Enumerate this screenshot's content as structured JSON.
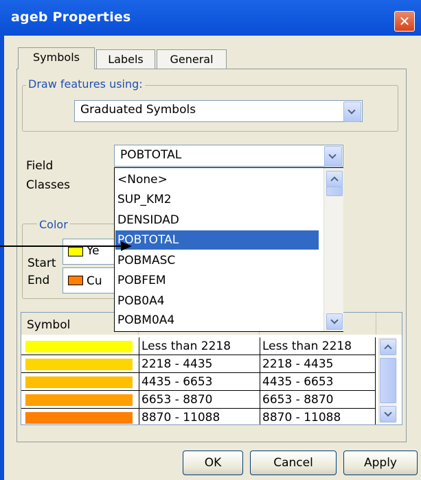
{
  "window": {
    "title": "ageb Properties",
    "close_glyph": "✕"
  },
  "tabs": [
    {
      "label": "Symbols",
      "active": true
    },
    {
      "label": "Labels",
      "active": false
    },
    {
      "label": "General",
      "active": false
    }
  ],
  "draw_group": {
    "legend": "Draw features using:",
    "selected": "Graduated Symbols"
  },
  "field": {
    "label": "Field",
    "selected": "POBTOTAL",
    "options": [
      "<None>",
      "SUP_KM2",
      "DENSIDAD",
      "POBTOTAL",
      "POBMASC",
      "POBFEM",
      "POB0A4",
      "POBM0A4"
    ],
    "highlighted_index": 3
  },
  "classes": {
    "label": "Classes"
  },
  "color_group": {
    "legend": "Color",
    "start_label": "Start",
    "start_value": "Ye",
    "start_color": "#ffff00",
    "end_label": "End",
    "end_value": "Cu",
    "end_color": "#ff7f00"
  },
  "symbol_table": {
    "header_symbol": "Symbol",
    "rows": [
      {
        "color": "#ffff00",
        "range": "Less than 2218",
        "label": "Less than 2218"
      },
      {
        "color": "#ffd500",
        "range": "2218 - 4435",
        "label": "2218 - 4435"
      },
      {
        "color": "#ffbf00",
        "range": "4435 - 6653",
        "label": "4435 - 6653"
      },
      {
        "color": "#ff9f00",
        "range": "6653 - 8870",
        "label": "6653 - 8870"
      },
      {
        "color": "#ff7f00",
        "range": "8870 - 11088",
        "label": "8870 - 11088"
      }
    ]
  },
  "buttons": {
    "ok": "OK",
    "cancel": "Cancel",
    "apply": "Apply"
  }
}
